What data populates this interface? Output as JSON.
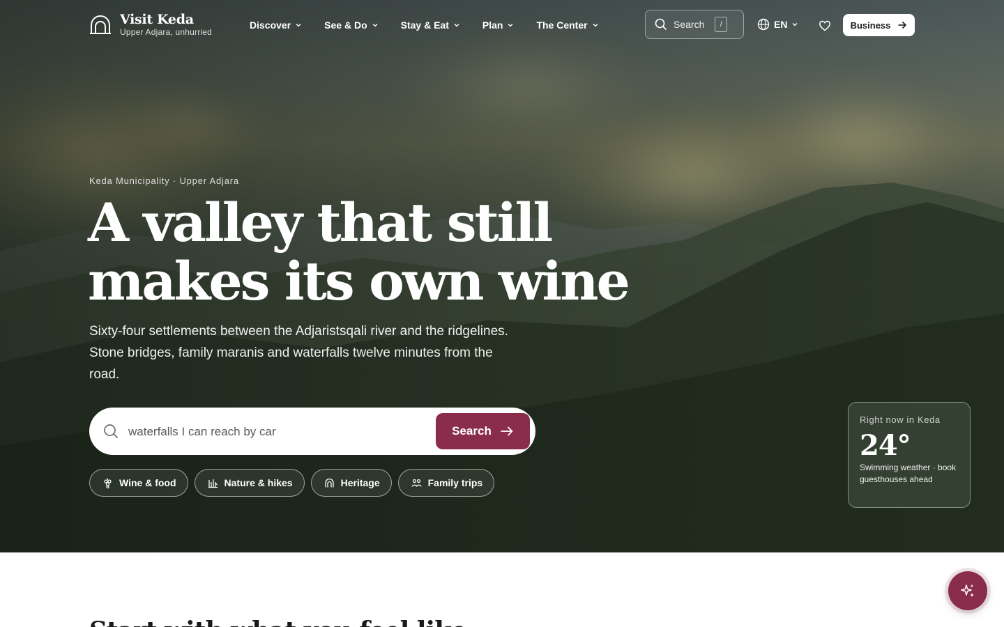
{
  "brand": {
    "title": "Visit Keda",
    "subtitle": "Upper Adjara, unhurried"
  },
  "nav": {
    "items": [
      {
        "label": "Discover"
      },
      {
        "label": "See & Do"
      },
      {
        "label": "Stay & Eat"
      },
      {
        "label": "Plan"
      },
      {
        "label": "The Center"
      }
    ],
    "search_label": "Search",
    "search_shortcut": "/",
    "language": "EN",
    "business_label": "Business"
  },
  "hero": {
    "eyebrow": "Keda Municipality · Upper Adjara",
    "headline": "A valley that still makes its own wine",
    "lede": "Sixty-four settlements between the Adjaristsqali river and the ridgelines. Stone bridges, family maranis and waterfalls twelve minutes from the road.",
    "search": {
      "value": "waterfalls I can reach by car",
      "placeholder": "waterfalls I can reach by car",
      "button_label": "Search"
    },
    "chips": [
      {
        "label": "Wine & food",
        "icon": "grape-icon"
      },
      {
        "label": "Nature & hikes",
        "icon": "forest-icon"
      },
      {
        "label": "Heritage",
        "icon": "arch-icon"
      },
      {
        "label": "Family trips",
        "icon": "family-icon"
      }
    ]
  },
  "weather": {
    "label": "Right now in Keda",
    "temperature": "24°",
    "note": "Swimming weather · book guesthouses ahead"
  },
  "section": {
    "title": "Start with what you feel like"
  },
  "colors": {
    "accent": "#8a2d4c",
    "hero_dark": "#1f2a1d"
  }
}
